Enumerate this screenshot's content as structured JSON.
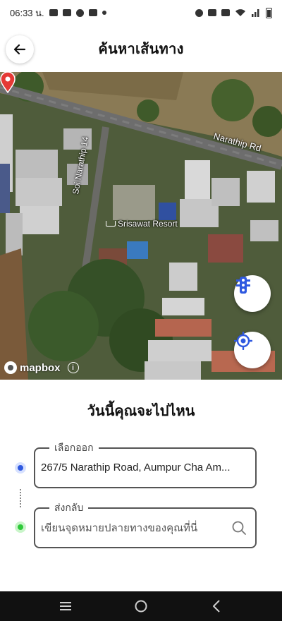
{
  "status_bar": {
    "time": "06:33 น.",
    "left_icons": [
      "youtube-icon",
      "cloud-icon",
      "chat-icon",
      "app-s-icon",
      "dot-icon"
    ],
    "right_icons": [
      "alarm-icon",
      "nfc-icon",
      "vibrate-icon",
      "wifi-icon",
      "signal-icon",
      "battery-icon"
    ]
  },
  "header": {
    "title": "ค้นหาเส้นทาง",
    "back_icon": "arrow-left-icon"
  },
  "map": {
    "road_main": "Narathip Rd",
    "road_soi": "Soi Narathip 14",
    "poi_label": "Srisawat Resort",
    "poi_icon": "bed-icon",
    "pin_color": "#e53935",
    "attribution": "mapbox",
    "fab_traffic_icon": "traffic-light-icon",
    "fab_locate_icon": "locate-icon",
    "accent": "#2f59e0"
  },
  "sheet": {
    "question": "วันนี้คุณจะไปไหน",
    "origin": {
      "label": "เลือกออก",
      "value": "267/5 Narathip Road, Aumpur Cha Am..."
    },
    "destination": {
      "label": "ส่งกลับ",
      "placeholder": "เขียนจุดหมายปลายทางของคุณที่นี่"
    }
  },
  "nav_bar": {
    "buttons": [
      "recent-apps-icon",
      "home-icon",
      "back-icon"
    ]
  }
}
